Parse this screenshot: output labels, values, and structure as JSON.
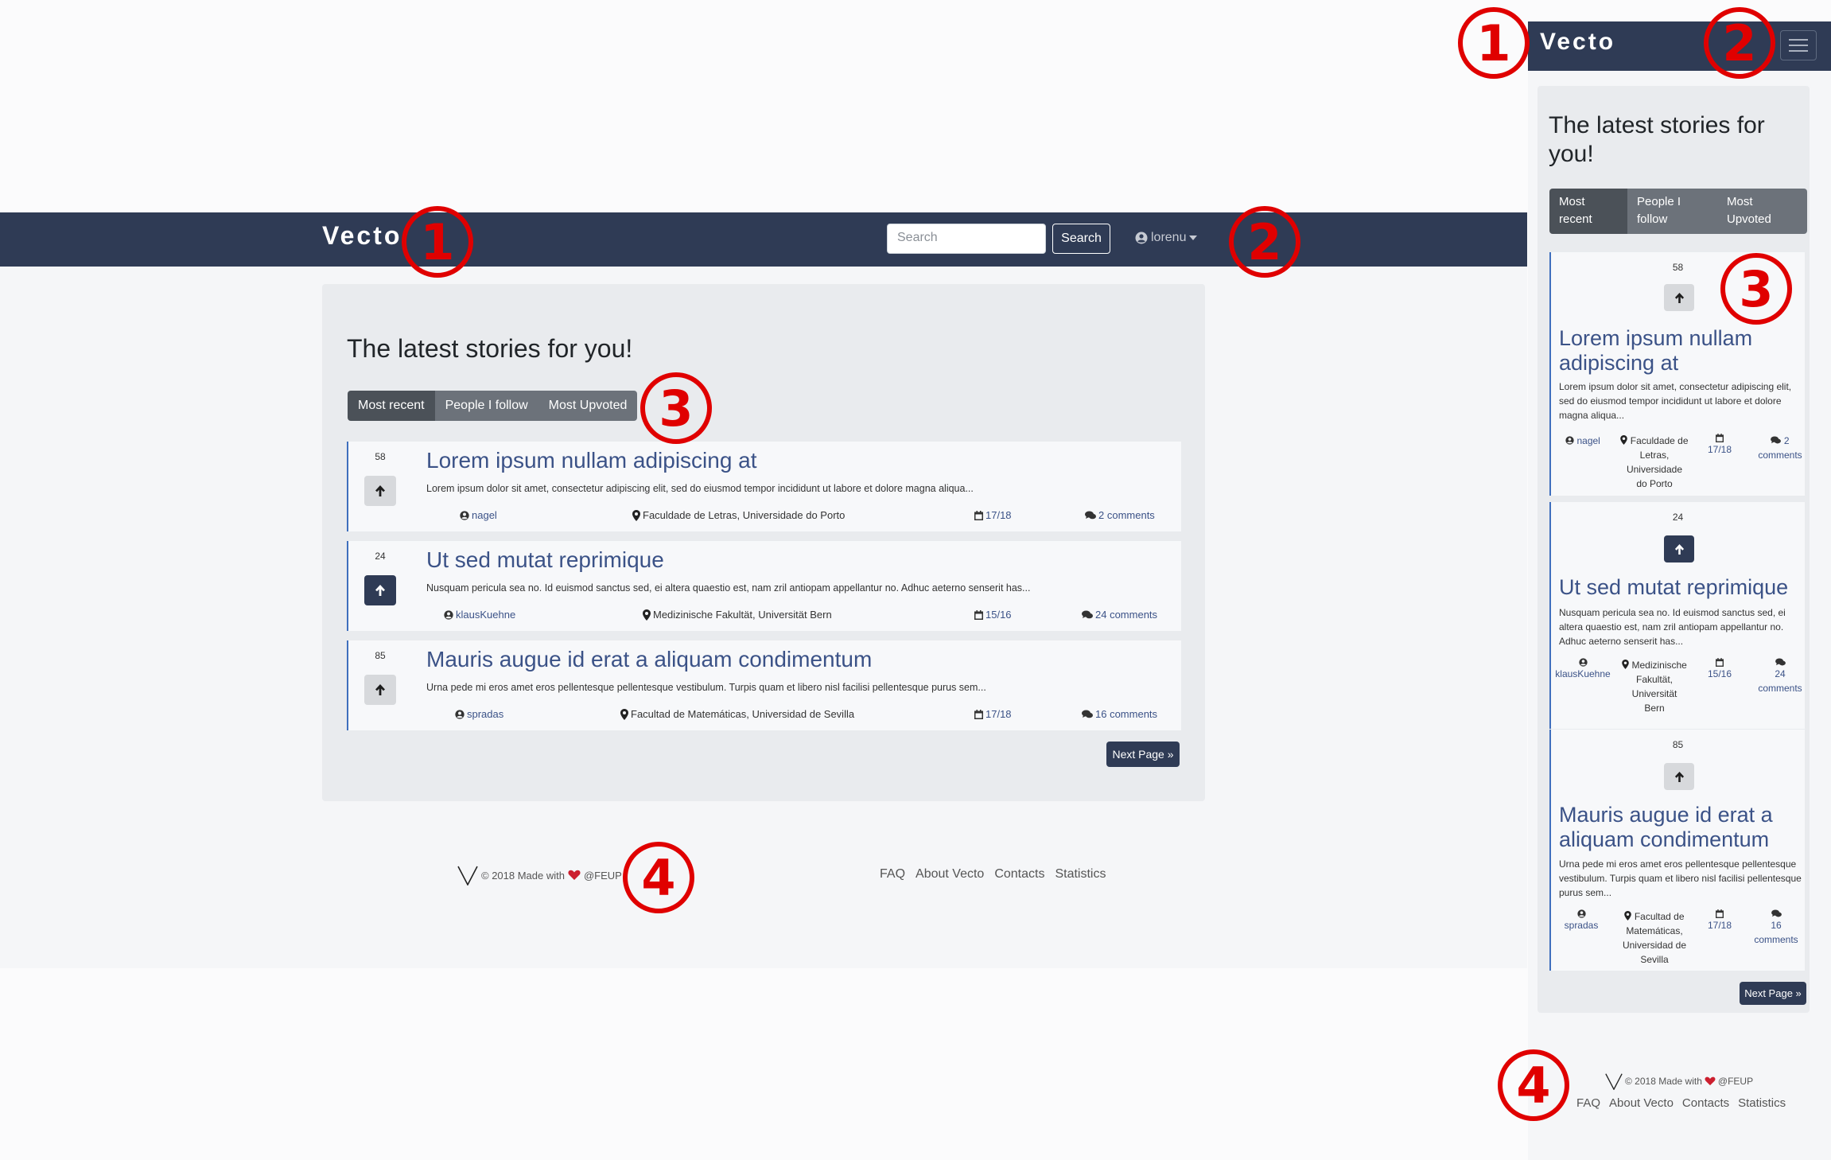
{
  "brand": "Vecto",
  "search": {
    "placeholder": "Search",
    "button": "Search"
  },
  "user": {
    "name": "lorenu"
  },
  "page_title": "The latest stories for you!",
  "tabs": [
    "Most recent",
    "People I follow",
    "Most Upvoted"
  ],
  "mobile_tabs": [
    {
      "line1": "Most",
      "line2": "recent"
    },
    {
      "line1": "People I",
      "line2": "follow"
    },
    {
      "line1": "Most",
      "line2": "Upvoted"
    }
  ],
  "stories": [
    {
      "votes": "58",
      "upvoted": false,
      "title": "Lorem ipsum nullam adipiscing at",
      "excerpt": "Lorem ipsum dolor sit amet, consectetur adipiscing elit, sed do eiusmod tempor incididunt ut labore et dolore magna aliqua...",
      "excerpt_mobile": [
        "Lorem ipsum dolor sit amet, consectetur adipiscing elit,",
        "sed do eiusmod tempor incididunt ut labore et dolore",
        "magna aliqua..."
      ],
      "author": "nagel",
      "location": "Faculdade de Letras, Universidade do Porto",
      "location_mobile": [
        "Faculdade de",
        "Letras,",
        "Universidade",
        "do Porto"
      ],
      "date": "17/18",
      "comments": "2 comments",
      "comments_mobile": [
        "2",
        "comments"
      ]
    },
    {
      "votes": "24",
      "upvoted": true,
      "title": "Ut sed mutat reprimique",
      "excerpt": "Nusquam pericula sea no. Id euismod sanctus sed, ei altera quaestio est, nam zril antiopam appellantur no. Adhuc aeterno senserit has...",
      "excerpt_mobile": [
        "Nusquam pericula sea no. Id euismod sanctus sed, ei",
        "altera quaestio est, nam zril antiopam appellantur no.",
        "Adhuc aeterno senserit has..."
      ],
      "author": "klausKuehne",
      "location": "Medizinische Fakultät, Universität Bern",
      "location_mobile": [
        "Medizinische",
        "Fakultät,",
        "Universität",
        "Bern"
      ],
      "date": "15/16",
      "comments": "24 comments",
      "comments_mobile": [
        "24",
        "comments"
      ]
    },
    {
      "votes": "85",
      "upvoted": false,
      "title": "Mauris augue id erat a aliquam condimentum",
      "excerpt": "Urna pede mi eros amet eros pellentesque pellentesque vestibulum. Turpis quam et libero nisl facilisi pellentesque purus sem...",
      "excerpt_mobile": [
        "Urna pede mi eros amet eros pellentesque pellentesque",
        "vestibulum. Turpis quam et libero nisl facilisi pellentesque",
        "purus sem..."
      ],
      "author": "spradas",
      "location": "Facultad de Matemáticas, Universidad de Sevilla",
      "location_mobile": [
        "Facultad de",
        "Matemáticas,",
        "Universidad de",
        "Sevilla"
      ],
      "date": "17/18",
      "comments": "16 comments",
      "comments_mobile": [
        "16",
        "comments"
      ]
    }
  ],
  "mobile_titles": [
    [
      "Lorem ipsum nullam",
      "adipiscing at"
    ],
    [
      "Ut sed mutat reprimique"
    ],
    [
      "Mauris augue id erat a",
      "aliquam condimentum"
    ]
  ],
  "next_page": "Next Page »",
  "footer": {
    "logo": "V",
    "made_with_prefix": "© 2018 Made with",
    "made_with_suffix": "@FEUP",
    "links": [
      "FAQ",
      "About Vecto",
      "Contacts",
      "Statistics"
    ]
  },
  "annotations": [
    "1",
    "2",
    "3",
    "4"
  ],
  "colors": {
    "navbar": "#2f3b55",
    "accent_blue": "#3b5287",
    "annotation_red": "#e00000",
    "heart_red": "#cc1f2f"
  }
}
